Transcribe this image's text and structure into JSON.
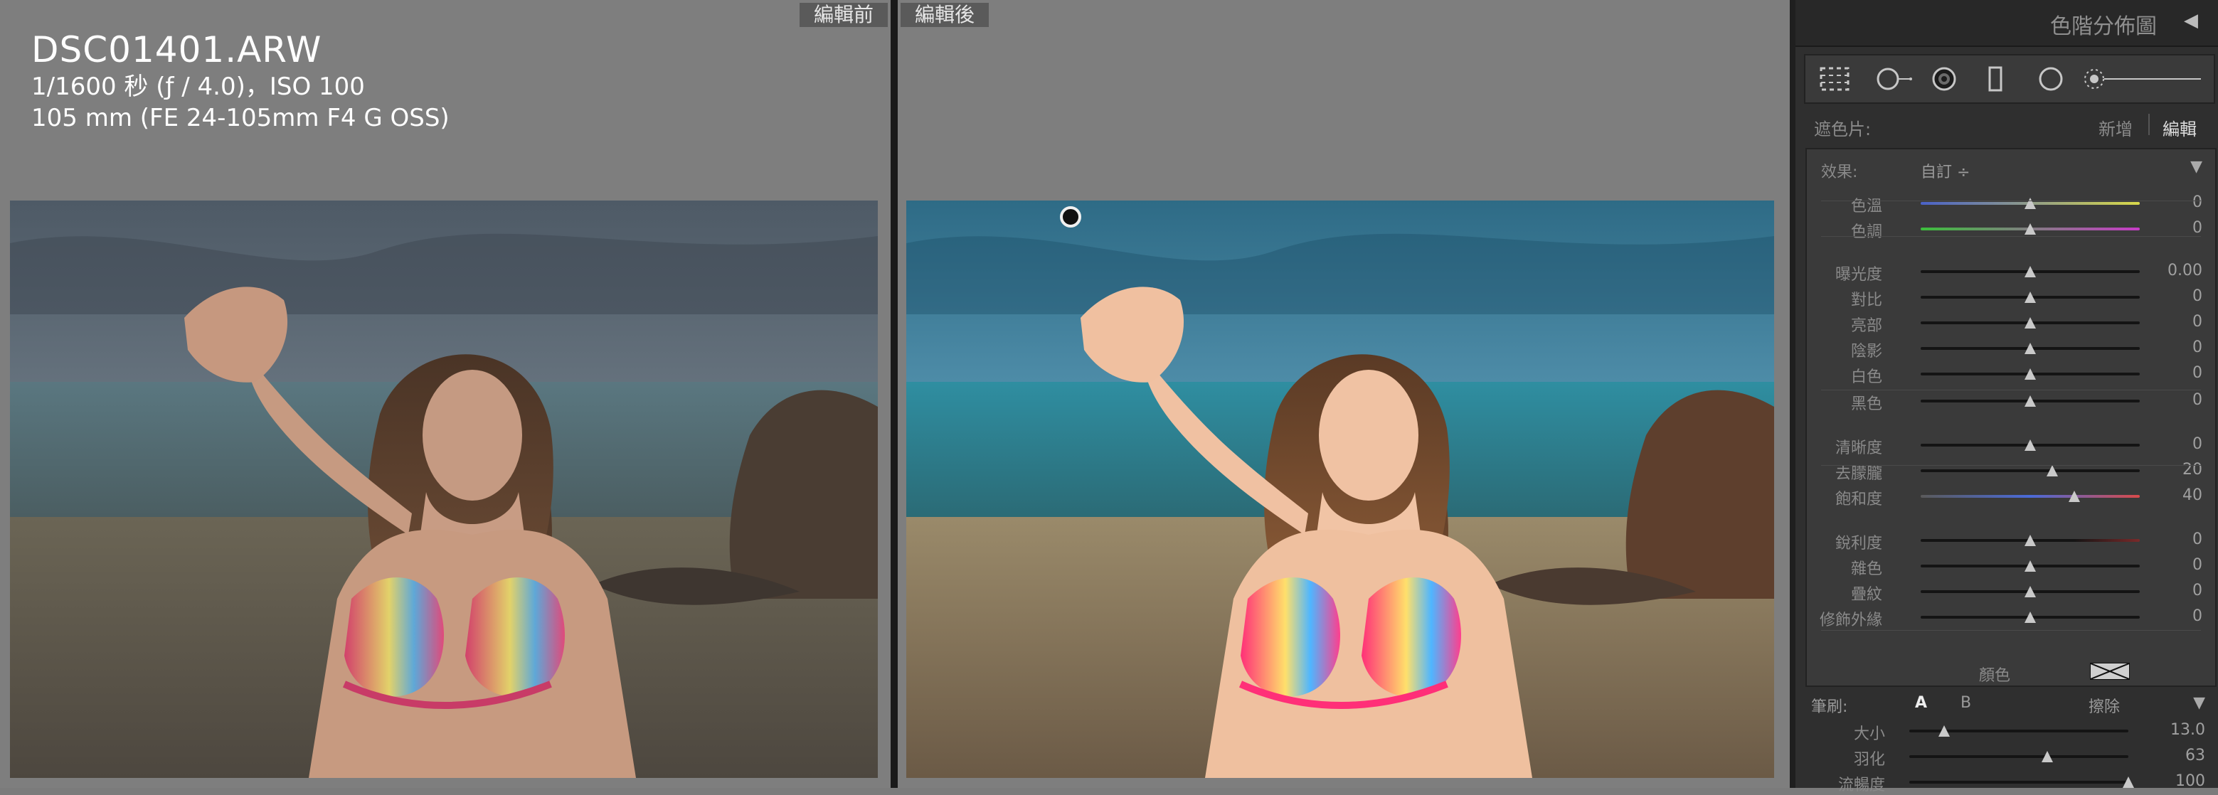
{
  "compare": {
    "before_label": "編輯前",
    "after_label": "編輯後",
    "file_name": "DSC01401.ARW",
    "meta_line1": "1/1600 秒 (ƒ / 4.0)，ISO 100",
    "meta_line2": "105 mm (FE 24-105mm F4 G OSS)"
  },
  "panel": {
    "title": "色階分佈圖",
    "collapse_icon": "triangle-left-icon",
    "tools": [
      "crop-overlay-icon",
      "spot-removal-icon",
      "red-eye-icon",
      "graduated-filter-icon",
      "radial-filter-icon",
      "adjustment-brush-icon"
    ],
    "mask_label": "遮色片:",
    "mask_new": "新增",
    "mask_edit": "編輯",
    "effect_label": "效果:",
    "effect_value": "自訂 ÷"
  },
  "sliders": [
    {
      "label": "色溫",
      "value": "0",
      "pos": 0.5,
      "color": "linear-gradient(90deg,#4a62c8,#d8d84a)"
    },
    {
      "label": "色調",
      "value": "0",
      "pos": 0.5,
      "color": "linear-gradient(90deg,#3cbf3c,#c83cc8)"
    },
    {
      "label": "曝光度",
      "value": "0.00",
      "pos": 0.5
    },
    {
      "label": "對比",
      "value": "0",
      "pos": 0.5
    },
    {
      "label": "亮部",
      "value": "0",
      "pos": 0.5
    },
    {
      "label": "陰影",
      "value": "0",
      "pos": 0.5
    },
    {
      "label": "白色",
      "value": "0",
      "pos": 0.5
    },
    {
      "label": "黑色",
      "value": "0",
      "pos": 0.5
    },
    {
      "label": "清晰度",
      "value": "0",
      "pos": 0.5
    },
    {
      "label": "去朦朧",
      "value": "20",
      "pos": 0.6
    },
    {
      "label": "飽和度",
      "value": "40",
      "pos": 0.7,
      "color": "linear-gradient(90deg,#5a5a5a,#4a6ad8,#d84a4a)"
    },
    {
      "label": "銳利度",
      "value": "0",
      "pos": 0.5,
      "color": "linear-gradient(90deg,#141414,#141414 70%,#7a2a2a)"
    },
    {
      "label": "雜色",
      "value": "0",
      "pos": 0.5
    },
    {
      "label": "疊紋",
      "value": "0",
      "pos": 0.5
    },
    {
      "label": "修飾外緣",
      "value": "0",
      "pos": 0.5
    }
  ],
  "color_label": "顏色",
  "brush": {
    "label": "筆刷:",
    "a": "A",
    "b": "B",
    "erase": "擦除",
    "rows": [
      {
        "label": "大小",
        "value": "13.0",
        "pos": 0.16
      },
      {
        "label": "羽化",
        "value": "63",
        "pos": 0.63
      },
      {
        "label": "流暢度",
        "value": "100",
        "pos": 1.0
      }
    ]
  }
}
